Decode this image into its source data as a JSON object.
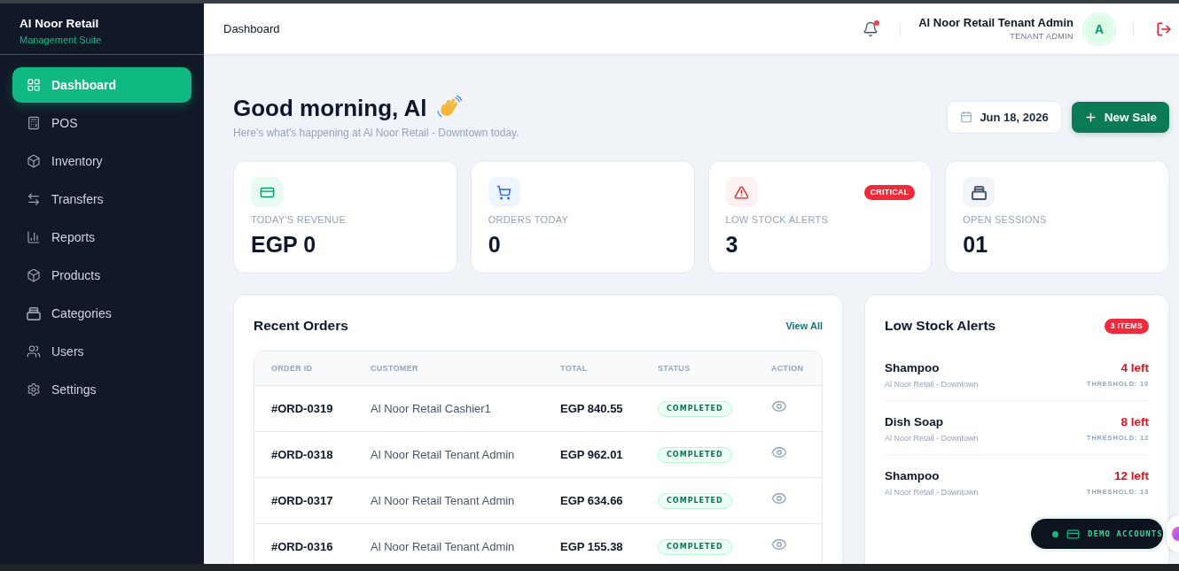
{
  "sidebar": {
    "brand": {
      "name": "Al Noor Retail",
      "tagline": "Management Suite"
    },
    "items": [
      {
        "label": "Dashboard",
        "selected": true
      },
      {
        "label": "POS",
        "selected": false
      },
      {
        "label": "Inventory",
        "selected": false
      },
      {
        "label": "Transfers",
        "selected": false
      },
      {
        "label": "Reports",
        "selected": false
      },
      {
        "label": "Products",
        "selected": false
      },
      {
        "label": "Categories",
        "selected": false
      },
      {
        "label": "Users",
        "selected": false
      },
      {
        "label": "Settings",
        "selected": false
      }
    ]
  },
  "header": {
    "title": "Dashboard",
    "notifications": {
      "unread": true
    },
    "user": {
      "name": "Al Noor Retail Tenant Admin",
      "role": "TENANT ADMIN",
      "initial": "A"
    }
  },
  "greeting": {
    "title": "Good morning, Al",
    "subtitle": "Here's what's happening at Al Noor Retail - Downtown today."
  },
  "date_button": {
    "label": "Jun 18, 2026"
  },
  "new_sale_button": {
    "label": "New Sale"
  },
  "stats": [
    {
      "kind": "revenue",
      "label": "TODAY'S REVENUE",
      "value": "EGP 0"
    },
    {
      "kind": "orders",
      "label": "ORDERS TODAY",
      "value": "0"
    },
    {
      "kind": "alerts",
      "label": "LOW STOCK ALERTS",
      "value": "3",
      "badge": "CRITICAL"
    },
    {
      "kind": "sessions",
      "label": "OPEN SESSIONS",
      "value": "01"
    }
  ],
  "recent_orders": {
    "title": "Recent Orders",
    "link": "View All",
    "columns": [
      "ORDER ID",
      "CUSTOMER",
      "TOTAL",
      "STATUS",
      "ACTION"
    ],
    "rows": [
      {
        "order_id": "#ORD-0319",
        "customer": "Al Noor Retail Cashier1",
        "total": "EGP 840.55",
        "status": "COMPLETED"
      },
      {
        "order_id": "#ORD-0318",
        "customer": "Al Noor Retail Tenant Admin",
        "total": "EGP 962.01",
        "status": "COMPLETED"
      },
      {
        "order_id": "#ORD-0317",
        "customer": "Al Noor Retail Tenant Admin",
        "total": "EGP 634.66",
        "status": "COMPLETED"
      },
      {
        "order_id": "#ORD-0316",
        "customer": "Al Noor Retail Tenant Admin",
        "total": "EGP 155.38",
        "status": "COMPLETED"
      }
    ]
  },
  "low_stock": {
    "title": "Low Stock Alerts",
    "badge": "3 ITEMS",
    "items": [
      {
        "name": "Shampoo",
        "location": "Al Noor Retail - Downtown",
        "remaining": "4 left",
        "threshold": "THRESHOLD: 10"
      },
      {
        "name": "Dish Soap",
        "location": "Al Noor Retail - Downtown",
        "remaining": "8 left",
        "threshold": "THRESHOLD: 12"
      },
      {
        "name": "Shampoo",
        "location": "Al Noor Retail - Downtown",
        "remaining": "12 left",
        "threshold": "THRESHOLD: 13"
      }
    ]
  },
  "demo_accounts": {
    "label": "DEMO ACCOUNTS"
  }
}
